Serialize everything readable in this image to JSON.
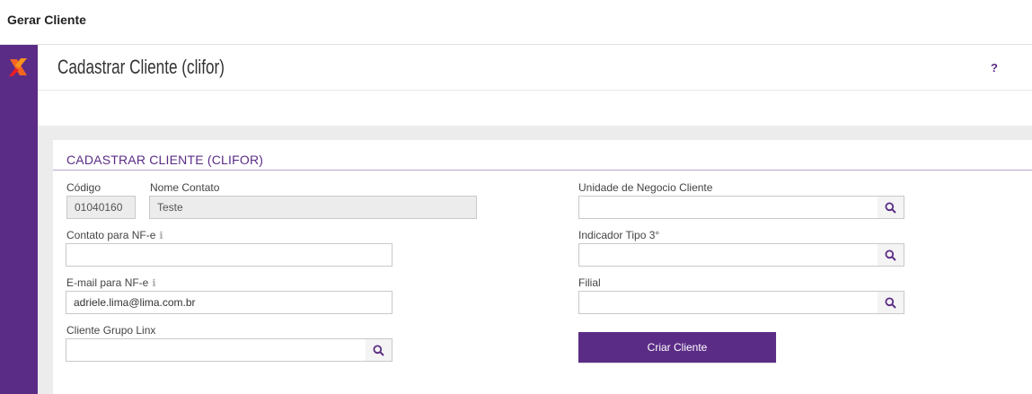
{
  "window": {
    "title": "Gerar Cliente"
  },
  "header": {
    "title": "Cadastrar Cliente (clifor)",
    "help": "?"
  },
  "form": {
    "section_title": "CADASTRAR CLIENTE (CLIFOR)",
    "codigo": {
      "label": "Código",
      "value": "01040160"
    },
    "nome_contato": {
      "label": "Nome Contato",
      "value": "Teste"
    },
    "contato_nfe": {
      "label": "Contato para NF-e",
      "value": ""
    },
    "email_nfe": {
      "label": "E-mail para NF-e",
      "value": "adriele.lima@lima.com.br"
    },
    "cliente_grupo_linx": {
      "label": "Cliente Grupo Linx",
      "value": ""
    },
    "unidade_negocio": {
      "label": "Unidade de Negocio Cliente",
      "value": ""
    },
    "indicador_tipo": {
      "label": "Indicador Tipo 3°",
      "value": ""
    },
    "filial": {
      "label": "Filial",
      "value": ""
    },
    "submit_label": "Criar Cliente"
  },
  "info_icon_glyph": "ℹ",
  "colors": {
    "brand": "#5b2c86",
    "section_line": "#b9a6cc"
  }
}
